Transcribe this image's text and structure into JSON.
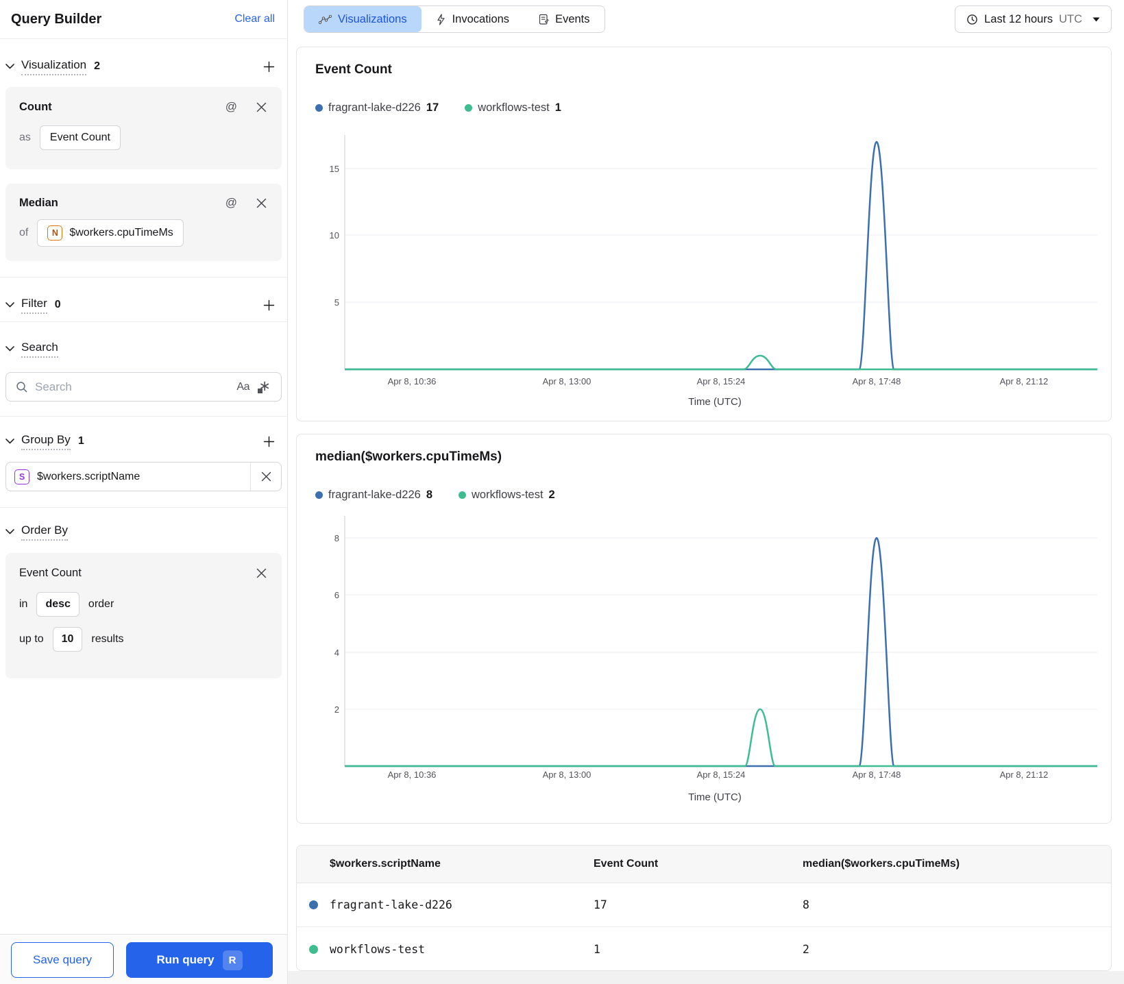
{
  "icons": {
    "at": "@",
    "match_case": "Aa",
    "regex_asterisk": "∗"
  },
  "colors": {
    "accent_blue": "#2563eb",
    "series_blue": "#3b6fad",
    "series_green": "#3dbd90",
    "active_tab_bg": "#b9d6fb",
    "active_tab_text": "#1a56db"
  },
  "sidebar": {
    "title": "Query Builder",
    "clear_all": "Clear all",
    "visualization_section": {
      "label": "Visualization",
      "count": "2"
    },
    "aggregations": [
      {
        "fn": "Count",
        "prep": "as",
        "value": "Event Count"
      },
      {
        "fn": "Median",
        "prep": "of",
        "value": "$workers.cpuTimeMs",
        "value_icon_letter": "N"
      }
    ],
    "filter_section": {
      "label": "Filter",
      "count": "0"
    },
    "search_section": {
      "label": "Search",
      "placeholder": "Search"
    },
    "group_by_section": {
      "label": "Group By",
      "count": "1",
      "field": "$workers.scriptName",
      "field_icon_letter": "S"
    },
    "order_by_section": {
      "label": "Order By",
      "field": "Event Count",
      "in_label": "in",
      "direction": "desc",
      "order_label": "order",
      "up_to_label": "up to",
      "limit": "10",
      "results_label": "results"
    },
    "save_button": "Save query",
    "run_button": "Run query",
    "run_shortcut": "R"
  },
  "topbar": {
    "tabs": [
      {
        "label": "Visualizations",
        "active": true
      },
      {
        "label": "Invocations",
        "active": false
      },
      {
        "label": "Events",
        "active": false
      }
    ],
    "time_range": {
      "label": "Last 12 hours",
      "timezone": "UTC"
    }
  },
  "chart_data": [
    {
      "type": "line",
      "title": "Event Count",
      "xlabel": "Time (UTC)",
      "x_ticks": [
        "Apr 8, 10:36",
        "Apr 8, 13:00",
        "Apr 8, 15:24",
        "Apr 8, 17:48",
        "Apr 8, 21:12"
      ],
      "yticks": [
        "5",
        "10",
        "15"
      ],
      "ylim": [
        0,
        17.5
      ],
      "grid": true,
      "legend_position": "top",
      "series": [
        {
          "name": "fragrant-lake-d226",
          "legend_value": "17",
          "color": "#3b6fad",
          "baseline_value": 0,
          "peak": {
            "x": "Apr 8, 17:48",
            "y": 17
          }
        },
        {
          "name": "workflows-test",
          "legend_value": "1",
          "color": "#3dbd90",
          "baseline_value": 0,
          "peak": {
            "x": "Apr 8, 16:00",
            "y": 1
          }
        }
      ]
    },
    {
      "type": "line",
      "title": "median($workers.cpuTimeMs)",
      "xlabel": "Time (UTC)",
      "x_ticks": [
        "Apr 8, 10:36",
        "Apr 8, 13:00",
        "Apr 8, 15:24",
        "Apr 8, 17:48",
        "Apr 8, 21:12"
      ],
      "yticks": [
        "2",
        "4",
        "6",
        "8"
      ],
      "ylim": [
        0,
        8.8
      ],
      "grid": true,
      "legend_position": "top",
      "series": [
        {
          "name": "fragrant-lake-d226",
          "legend_value": "8",
          "color": "#3b6fad",
          "baseline_value": 0,
          "peak": {
            "x": "Apr 8, 17:48",
            "y": 8
          }
        },
        {
          "name": "workflows-test",
          "legend_value": "2",
          "color": "#3dbd90",
          "baseline_value": 0,
          "peak": {
            "x": "Apr 8, 16:00",
            "y": 2
          }
        }
      ]
    }
  ],
  "table": {
    "columns": [
      "$workers.scriptName",
      "Event Count",
      "median($workers.cpuTimeMs)"
    ],
    "rows": [
      {
        "script_name": "fragrant-lake-d226",
        "event_count": "17",
        "median": "8",
        "dot_color": "#3b6fad"
      },
      {
        "script_name": "workflows-test",
        "event_count": "1",
        "median": "2",
        "dot_color": "#3dbd90"
      }
    ]
  }
}
